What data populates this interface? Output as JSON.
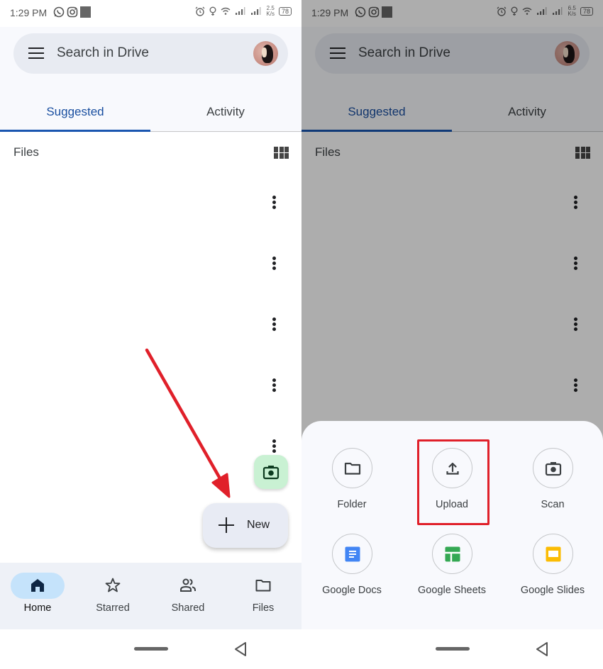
{
  "left_screen": {
    "status_bar": {
      "time": "1:29 PM",
      "app_icons": [
        "whatsapp-icon",
        "instagram-icon",
        "app-square-icon"
      ],
      "net_speed_value": "2.5",
      "net_speed_unit": "K/s",
      "battery": "78"
    },
    "search": {
      "placeholder": "Search in Drive"
    },
    "tabs": [
      {
        "label": "Suggested",
        "active": true
      },
      {
        "label": "Activity",
        "active": false
      }
    ],
    "files_section": {
      "label": "Files",
      "file_row_count": 5
    },
    "fab_scan_icon": "camera-icon",
    "fab_new": {
      "label": "New"
    },
    "bottom_nav": [
      {
        "label": "Home",
        "icon": "home-icon",
        "active": true
      },
      {
        "label": "Starred",
        "icon": "star-icon",
        "active": false
      },
      {
        "label": "Shared",
        "icon": "shared-people-icon",
        "active": false
      },
      {
        "label": "Files",
        "icon": "folder-icon",
        "active": false
      }
    ],
    "annotation": {
      "type": "arrow",
      "color": "#e0202a",
      "points_to": "New"
    }
  },
  "right_screen": {
    "status_bar": {
      "time": "1:29 PM",
      "app_icons": [
        "whatsapp-icon",
        "instagram-icon",
        "app-square-icon"
      ],
      "net_speed_value": "6.5",
      "net_speed_unit": "K/s",
      "battery": "78"
    },
    "search": {
      "placeholder": "Search in Drive"
    },
    "tabs": [
      {
        "label": "Suggested",
        "active": true
      },
      {
        "label": "Activity",
        "active": false
      }
    ],
    "files_section": {
      "label": "Files"
    },
    "create_sheet": {
      "items": [
        {
          "label": "Folder",
          "icon": "folder-icon"
        },
        {
          "label": "Upload",
          "icon": "upload-icon",
          "highlighted": true
        },
        {
          "label": "Scan",
          "icon": "camera-icon"
        },
        {
          "label": "Google Docs",
          "icon": "google-docs-icon",
          "color": "#4285f4"
        },
        {
          "label": "Google Sheets",
          "icon": "google-sheets-icon",
          "color": "#34a853"
        },
        {
          "label": "Google Slides",
          "icon": "google-slides-icon",
          "color": "#fbbc04"
        }
      ],
      "highlight_color": "#e0202a"
    }
  },
  "colors": {
    "accent_blue": "#1a56b0",
    "active_nav_pill": "#c5e3fb",
    "fab_scan_bg": "#c9f1d3",
    "annotation_red": "#e0202a"
  }
}
